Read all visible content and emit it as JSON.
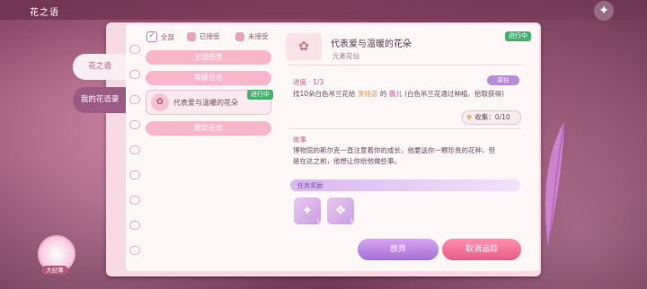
{
  "header": {
    "title": "花之语",
    "star_icon": "✦"
  },
  "tabs": [
    {
      "label": "花之语"
    },
    {
      "label": "我的花语录"
    }
  ],
  "filters": [
    {
      "label": "全部",
      "checked": true
    },
    {
      "label": "已接受",
      "checked": false
    },
    {
      "label": "未接受",
      "checked": false
    }
  ],
  "tasks": {
    "main": "主线任务",
    "grade": "等级任务",
    "current": "代表爱与温暖的花朵",
    "current_badge": "进行中",
    "limited": "限定任务"
  },
  "quest": {
    "title": "代表爱与温暖的花朵",
    "badge": "进行中",
    "subtitle": "元素花仙",
    "progress_label": "进度 · 1/3",
    "goto_label": "前往",
    "progress_text_a": "找10朵白色吊兰花给 ",
    "progress_place": "烹饪店",
    "progress_text_b": " 的 ",
    "progress_name": "薇儿",
    "progress_text_c": " (白色吊兰花通过种植、拾取获得)",
    "collect_label": "收集：0/10",
    "story_label": "故事",
    "story_line1": "博物馆的斯尔克一直注意着你的成长，他要送你一颗珍贵的花种，但",
    "story_line2": "是在这之前，他想让你给他做些事。",
    "reward_label": "任务奖励",
    "rewards": [
      {
        "icon": "sparkle-coins-icon",
        "count": "1"
      },
      {
        "icon": "gem-box-icon",
        "count": "3"
      }
    ],
    "quit_label": "放弃",
    "cancel_label": "取消追踪"
  },
  "avatar_label": "大纪事"
}
